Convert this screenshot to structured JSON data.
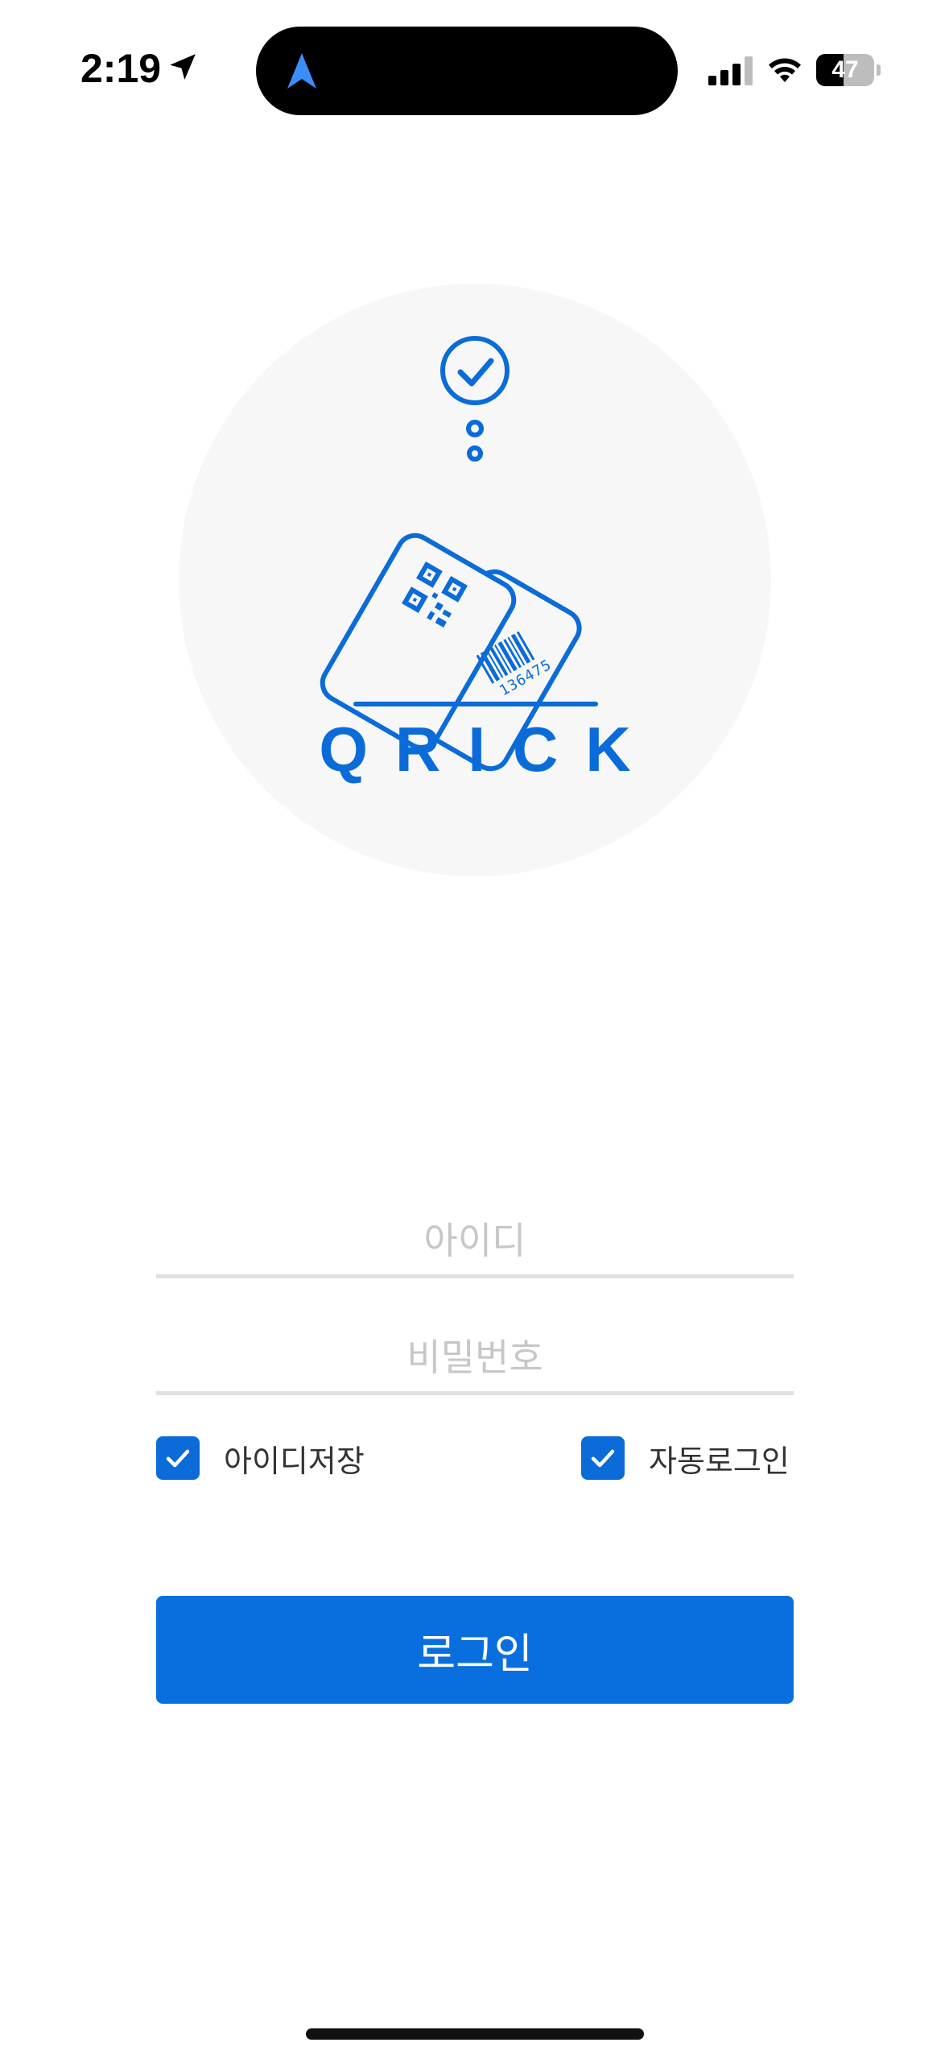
{
  "status_bar": {
    "time": "2:19",
    "battery_level": "47",
    "battery_percent": 47
  },
  "logo": {
    "brand": "QRICK",
    "barcode_number": "136475",
    "brand_color": "#0a6bd9"
  },
  "form": {
    "id_placeholder": "아이디",
    "id_value": "",
    "password_placeholder": "비밀번호",
    "password_value": "",
    "save_id_label": "아이디저장",
    "save_id_checked": true,
    "auto_login_label": "자동로그인",
    "auto_login_checked": true,
    "login_button_label": "로그인"
  },
  "icons": [
    "location-arrow-icon",
    "navigation-arrow-icon",
    "signal-icon",
    "wifi-icon",
    "battery-icon",
    "check-icon"
  ],
  "colors": {
    "accent": "#0a6fde",
    "divider": "#e0e0e0",
    "placeholder": "#c7c7c7",
    "logo_background": "#f7f7f7"
  }
}
